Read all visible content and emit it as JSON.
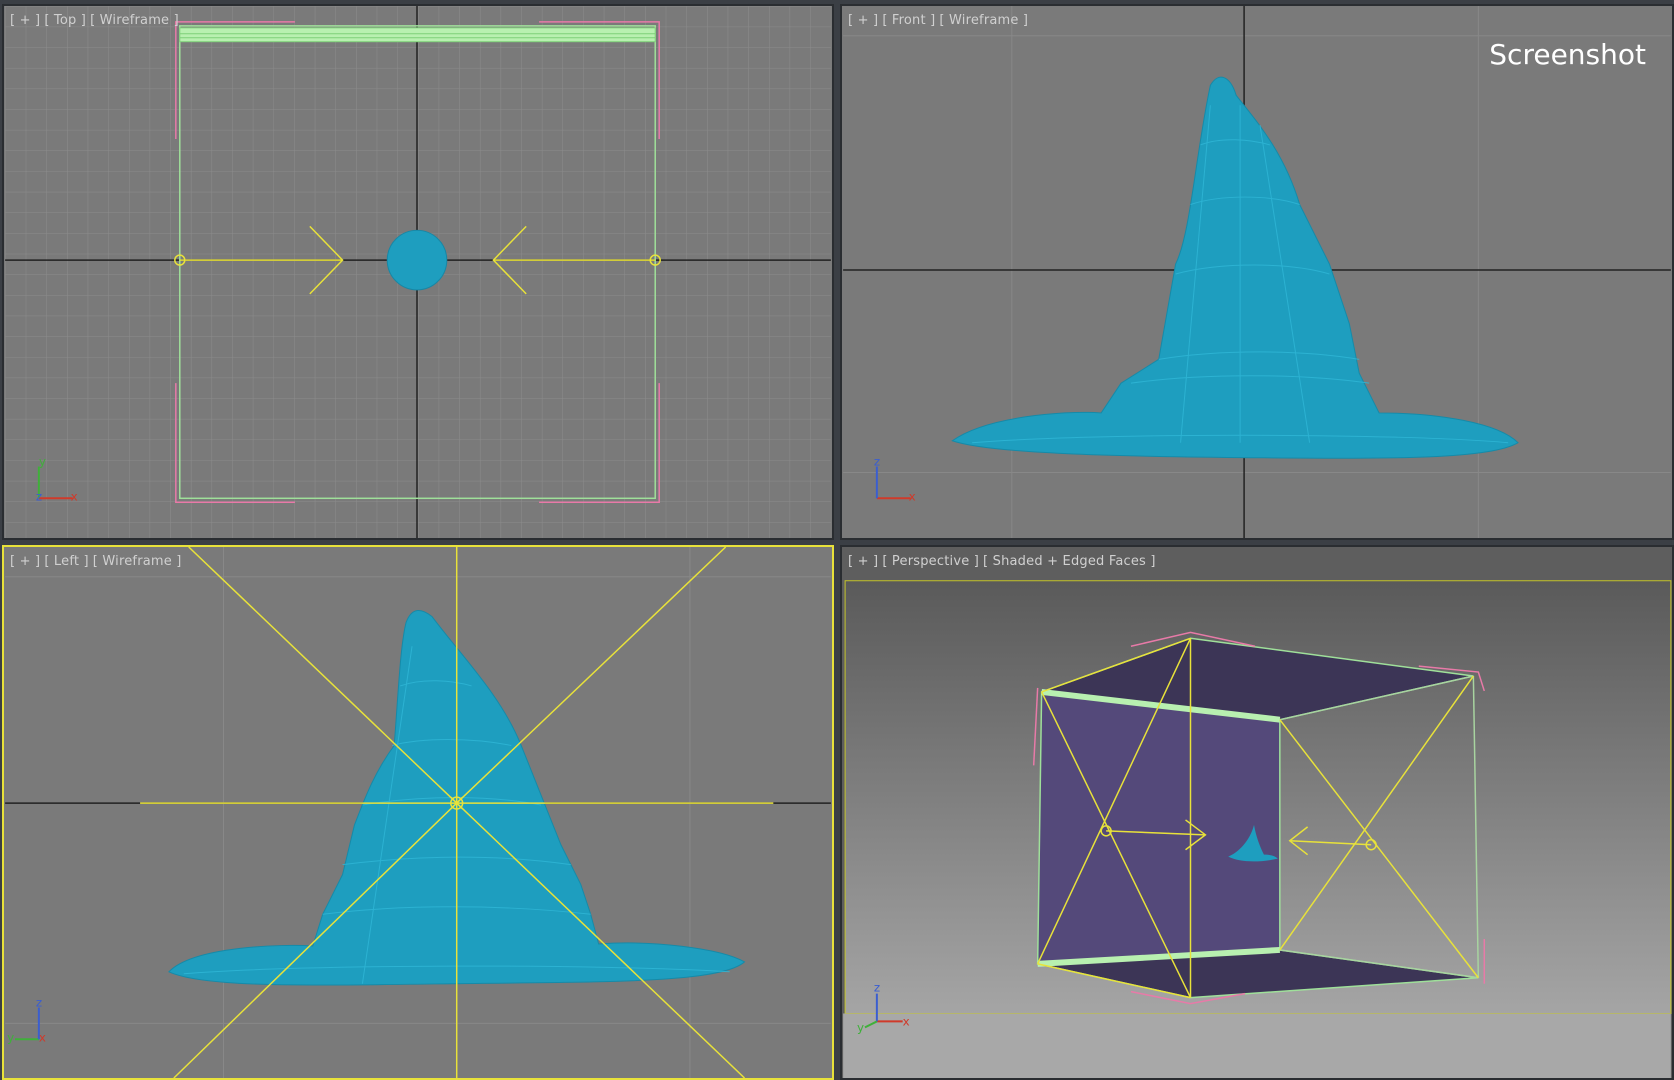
{
  "viewports": {
    "top": {
      "menu": "[ + ]",
      "view": "[ Top ]",
      "mode": "[ Wireframe ]"
    },
    "front": {
      "menu": "[ + ]",
      "view": "[ Front ]",
      "mode": "[ Wireframe ]"
    },
    "left": {
      "menu": "[ + ]",
      "view": "[ Left ]",
      "mode": "[ Wireframe ]"
    },
    "perspective": {
      "menu": "[ + ]",
      "view": "[ Perspective ]",
      "mode": "[ Shaded + Edged Faces ]"
    }
  },
  "watermark": "Screenshot",
  "axes": {
    "top": {
      "up": "y",
      "right": "x",
      "depth": "z"
    },
    "front": {
      "up": "z",
      "right": "x"
    },
    "left": {
      "up": "z",
      "right": "x",
      "depth": "y"
    },
    "perspective": {
      "up": "z",
      "right": "x",
      "depth": "y"
    }
  },
  "colors": {
    "viewport_bg": "#7a7a7a",
    "active_border": "#e8e23a",
    "hat": "#1e9ebf",
    "gizmo": "#e8e23a",
    "selection_bracket": "#e87aa8",
    "box_edge": "#9fe09a",
    "box_face": "#54497a",
    "axis_x": "#d03a2a",
    "axis_y": "#3fb03a",
    "axis_z": "#3a5ed0"
  },
  "icons": [
    "crosshair-icon",
    "axis-tripod-icon"
  ]
}
